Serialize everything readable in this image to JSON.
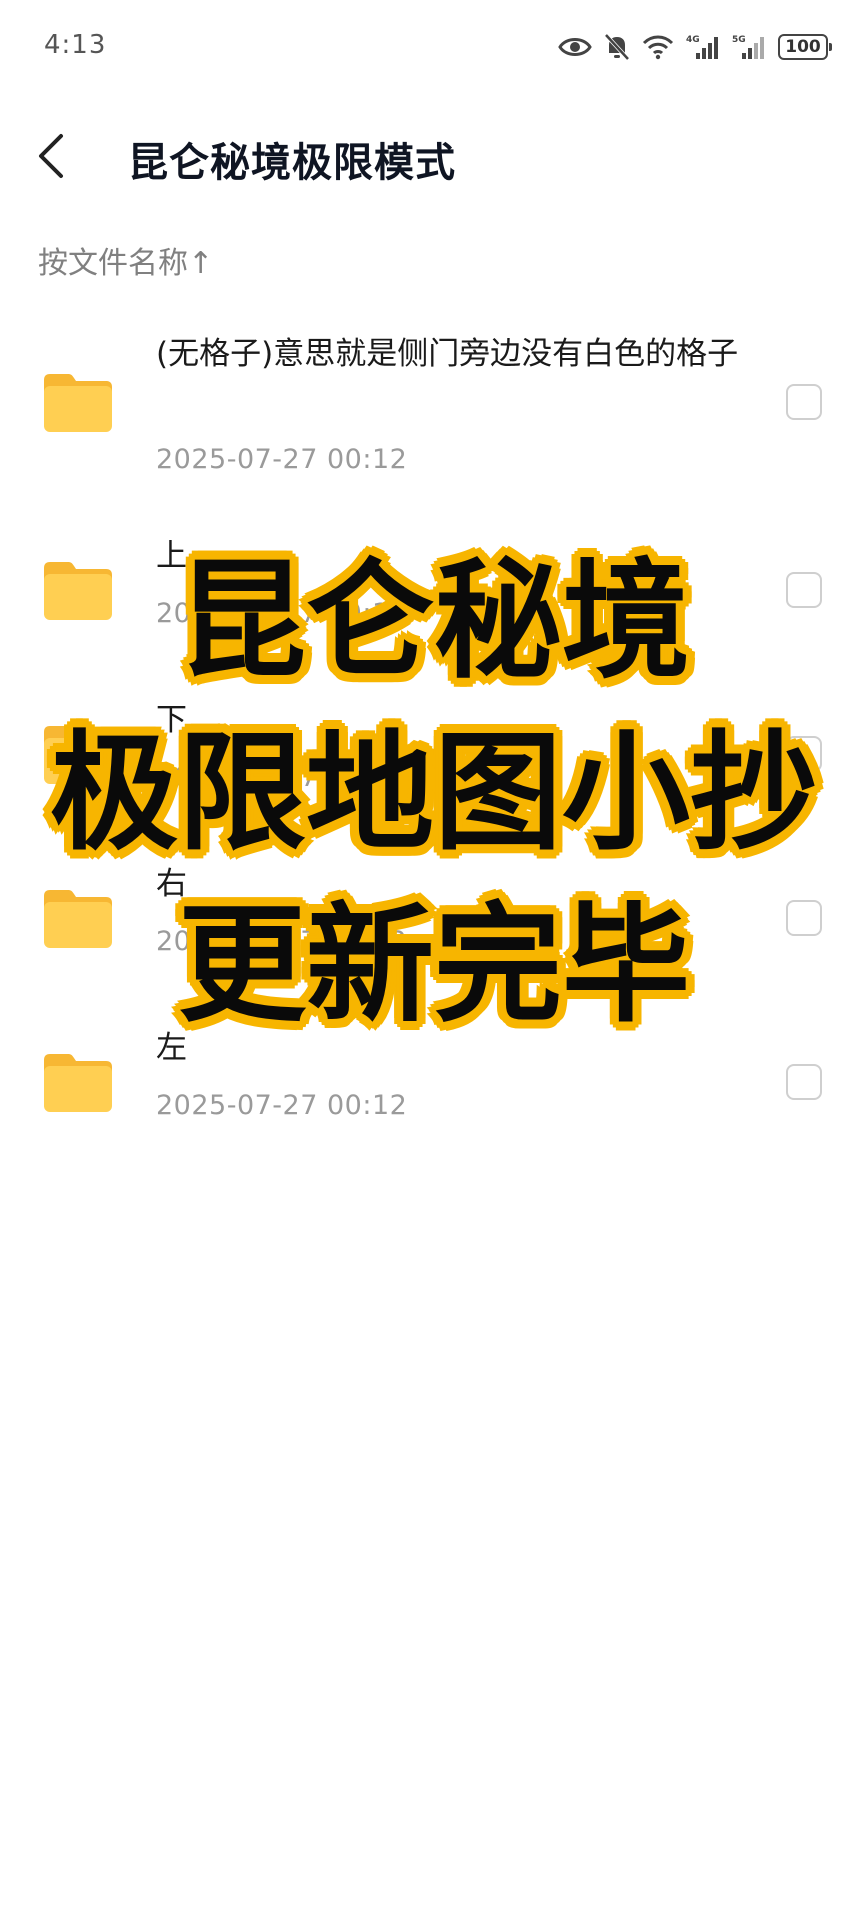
{
  "status_bar": {
    "time": "4:13",
    "icons": [
      "eye-icon",
      "bell-muted-icon",
      "wifi-icon",
      "signal-4g-icon",
      "signal-5g-icon"
    ],
    "battery": "100"
  },
  "header": {
    "title": "昆仑秘境极限模式"
  },
  "sort": {
    "label": "按文件名称↑"
  },
  "files": [
    {
      "name": "(无格子)意思就是侧门旁边没有白色的格子",
      "date": "2025-07-27 00:12"
    },
    {
      "name": "上",
      "date": "2025-07-27 00:12"
    },
    {
      "name": "下",
      "date": "2025-07-27 00:12"
    },
    {
      "name": "右",
      "date": "2025-07-27 00:12"
    },
    {
      "name": "左",
      "date": "2025-07-27 00:12"
    }
  ],
  "overlay": {
    "line1": "昆仑秘境",
    "line2": "极限地图小抄",
    "line3": "更新完毕"
  },
  "colors": {
    "folder": "#ffcc4d",
    "overlay_outline": "#f7b500",
    "overlay_text": "#0a0a0a"
  }
}
